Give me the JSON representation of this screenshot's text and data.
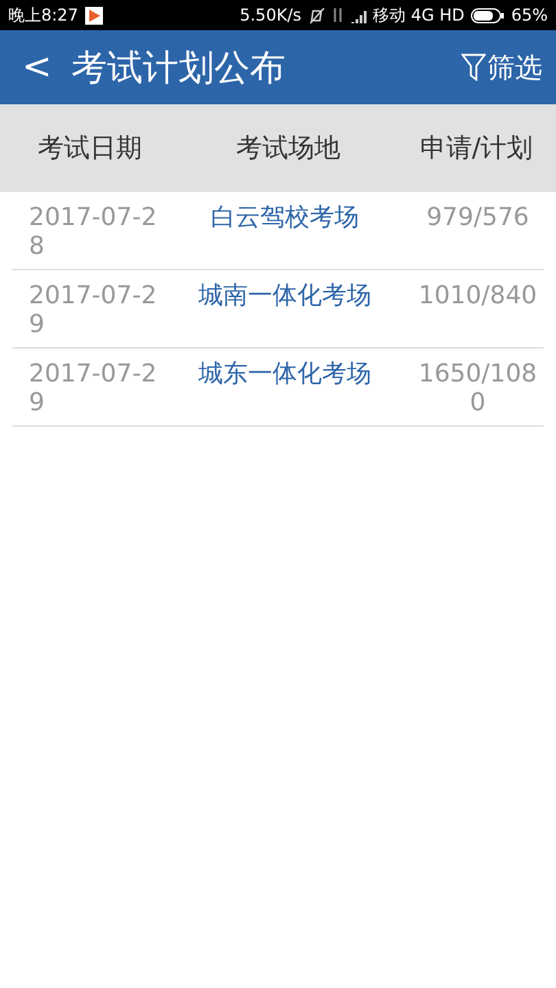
{
  "status_bar": {
    "time": "晚上8:27",
    "speed": "5.50K/s",
    "carrier": "移动 4G HD",
    "battery": "65%"
  },
  "app_bar": {
    "back": "<",
    "title": "考试计划公布",
    "filter": "筛选"
  },
  "table": {
    "columns": [
      "考试日期",
      "考试场地",
      "申请/计划"
    ],
    "rows": [
      {
        "date": "2017-07-28",
        "venue": "白云驾校考场",
        "count": "979/576"
      },
      {
        "date": "2017-07-29",
        "venue": "城南一体化考场",
        "count": "1010/840"
      },
      {
        "date": "2017-07-29",
        "venue": "城东一体化考场",
        "count": "1650/1080"
      }
    ]
  }
}
